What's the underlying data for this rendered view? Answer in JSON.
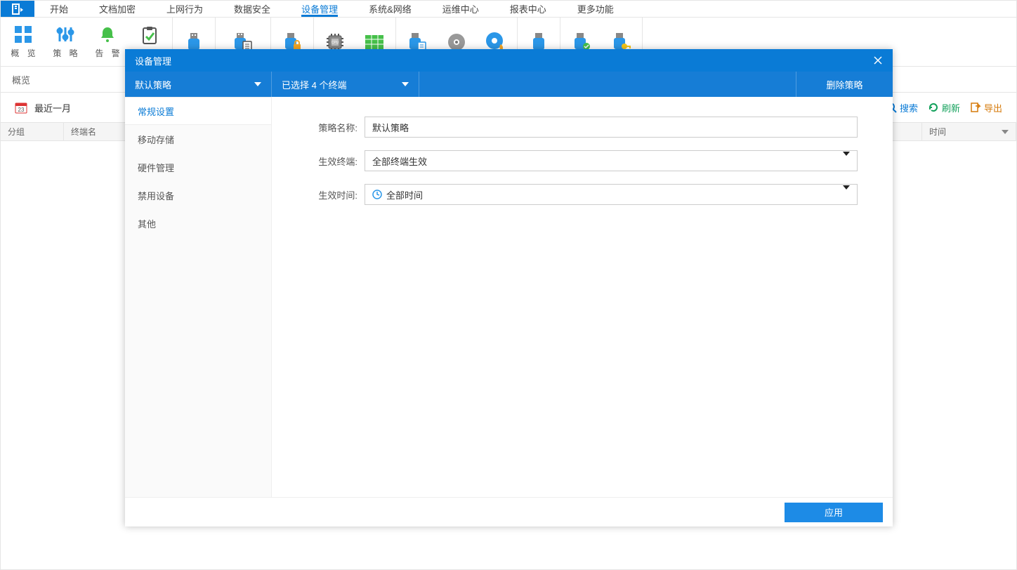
{
  "menu": {
    "items": [
      "开始",
      "文档加密",
      "上网行为",
      "数据安全",
      "设备管理",
      "系统&网络",
      "运维中心",
      "报表中心",
      "更多功能"
    ],
    "active_index": 4
  },
  "ribbon": {
    "labeled": [
      {
        "label": "概  览",
        "name": "overview"
      },
      {
        "label": "策  略",
        "name": "policy"
      },
      {
        "label": "告  警",
        "name": "alert"
      }
    ]
  },
  "subheader": {
    "title": "概览"
  },
  "filterbar": {
    "recent_label": "最近一月",
    "search": "搜索",
    "refresh": "刷新",
    "export": "导出"
  },
  "table": {
    "cols": [
      "分组",
      "终端名",
      "时间"
    ]
  },
  "modal": {
    "title": "设备管理",
    "policy_dd": "默认策略",
    "terminal_dd": "已选择 4 个终端",
    "delete_btn": "删除策略",
    "sidebar": [
      "常规设置",
      "移动存储",
      "硬件管理",
      "禁用设备",
      "其他"
    ],
    "sidebar_active": 0,
    "form": {
      "name_label": "策略名称:",
      "name_value": "默认策略",
      "scope_label": "生效终端:",
      "scope_value": "全部终端生效",
      "time_label": "生效时间:",
      "time_value": "全部时间"
    },
    "apply": "应用"
  }
}
